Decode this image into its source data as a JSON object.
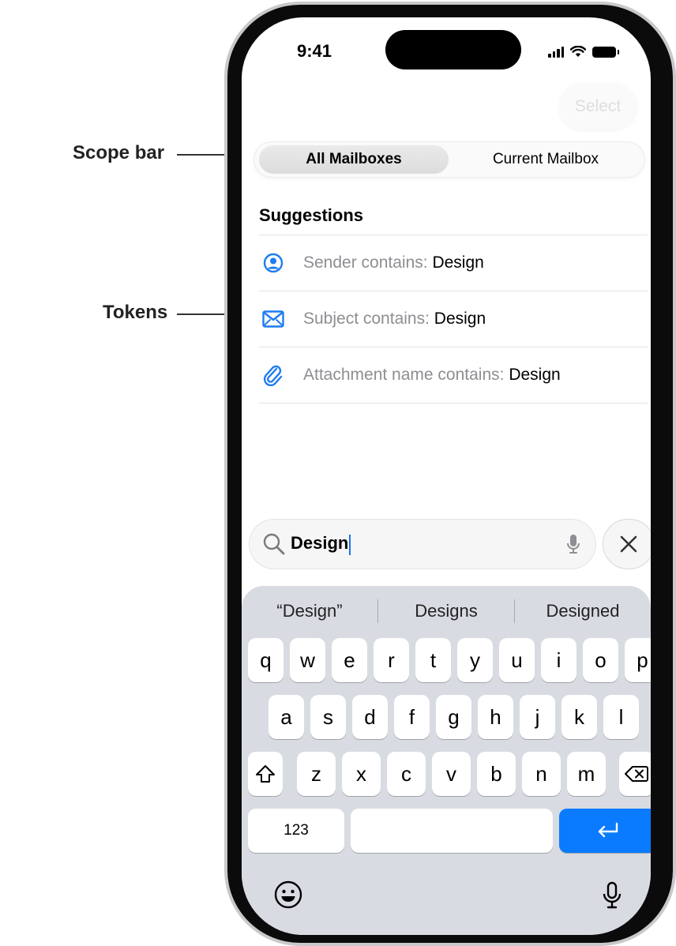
{
  "callouts": {
    "scope_bar": "Scope bar",
    "tokens": "Tokens"
  },
  "status": {
    "time": "9:41"
  },
  "nav": {
    "select_label": "Select"
  },
  "scope_bar": {
    "segments": [
      "All Mailboxes",
      "Current Mailbox"
    ],
    "selected": "All Mailboxes"
  },
  "suggestions": {
    "header": "Suggestions",
    "items": [
      {
        "icon": "person-circle-icon",
        "key": "Sender contains:",
        "value": "Design"
      },
      {
        "icon": "envelope-icon",
        "key": "Subject contains:",
        "value": "Design"
      },
      {
        "icon": "paperclip-icon",
        "key": "Attachment name contains:",
        "value": "Design"
      }
    ]
  },
  "search": {
    "value": "Design"
  },
  "keyboard": {
    "predictions": [
      "“Design”",
      "Designs",
      "Designed"
    ],
    "row1": [
      "q",
      "w",
      "e",
      "r",
      "t",
      "y",
      "u",
      "i",
      "o",
      "p"
    ],
    "row2": [
      "a",
      "s",
      "d",
      "f",
      "g",
      "h",
      "j",
      "k",
      "l"
    ],
    "row3": [
      "z",
      "x",
      "c",
      "v",
      "b",
      "n",
      "m"
    ],
    "numbers_label": "123"
  },
  "colors": {
    "accent": "#0A7BFF",
    "token_icon": "#1E7CF2",
    "keyboard_bg": "#D8DBE1"
  }
}
